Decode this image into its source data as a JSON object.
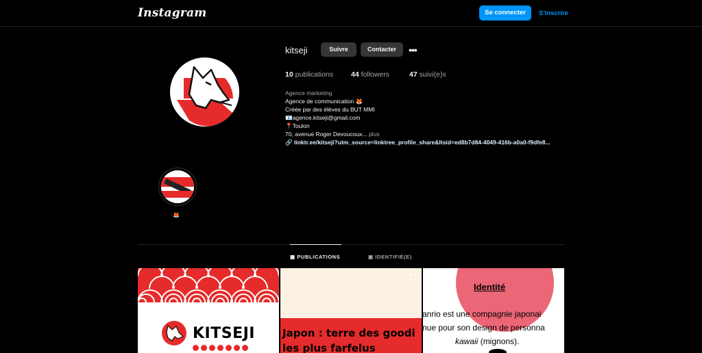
{
  "header": {
    "logo_text": "Instagram",
    "login_label": "Se connecter",
    "signup_label": "S'inscrire"
  },
  "profile": {
    "username": "kitseji",
    "follow_label": "Suivre",
    "contact_label": "Contacter",
    "more_label": "•••",
    "stats": {
      "publications_count": "10",
      "publications_label": "publications",
      "followers_count": "44",
      "followers_label": "followers",
      "following_count": "47",
      "following_label": "suivi(e)s"
    },
    "bio": {
      "category": "Agence marketing",
      "line1": "Agence de communication 🦊",
      "line2": "Créée par des élèves du BUT MMI",
      "line3": "📧agence.kitseji@gmail.com",
      "line4": "📍Toulon",
      "line5": "70, avenue Roger Devoucoux...",
      "more_label": "plus",
      "link": "linktr.ee/kitseji?utm_source=linktree_profile_share&ltsid=ed8b7d84-4049-416b-a0a0-f9dfe8..."
    }
  },
  "highlights": [
    {
      "label": "🦊"
    }
  ],
  "tabs": {
    "publications_label": "PUBLICATIONS",
    "tagged_label": "IDENTIFIÉ(E)"
  },
  "posts": {
    "post1": {
      "brand": "KITSEJI"
    },
    "post2": {
      "line1": "Japon : terre des goodi",
      "line2": "les plus farfelus"
    },
    "post3": {
      "title": "Identité",
      "line1": "anrio est une compagnie japonai",
      "line2": "nue pour son design de personna",
      "line3_italic": "kawaii",
      "line3_rest": " (mignons)."
    }
  },
  "colors": {
    "accent_blue": "#0095f6",
    "brand_red": "#e52b2b",
    "pink": "#eb6676"
  }
}
